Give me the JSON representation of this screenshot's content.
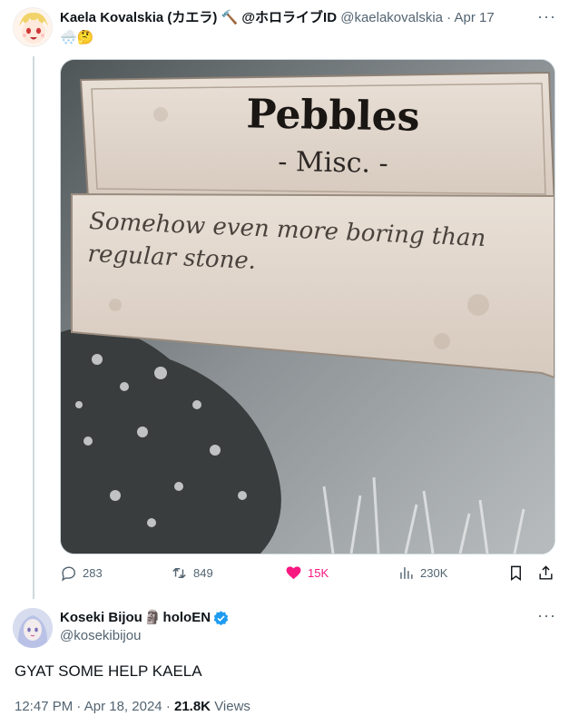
{
  "tweet1": {
    "author_name": "Kaela Kovalskia (カエラ) 🔨 @ホロライブID",
    "handle": "@kaelakovalskia",
    "separator": "·",
    "date": "Apr 17",
    "text": "🌨️🤔",
    "media": {
      "title": "Pebbles",
      "subtitle": "- Misc. -",
      "description": "Somehow even more boring than regular stone."
    },
    "actions": {
      "replies": "283",
      "reposts": "849",
      "likes": "15K",
      "views": "230K"
    }
  },
  "tweet2": {
    "author_name": "Koseki Bijou",
    "name_emoji": "🗿",
    "name_suffix": "holoEN",
    "handle": "@kosekibijou",
    "text": "GYAT SOME HELP KAELA",
    "time": "12:47 PM",
    "date": "Apr 18, 2024",
    "views_count": "21.8K",
    "views_label": "Views",
    "separator": "·"
  },
  "more_icon_label": "···",
  "colors": {
    "like": "#f91880",
    "verified": "#1d9bf0",
    "muted": "#536471",
    "line": "#cfd9de"
  }
}
